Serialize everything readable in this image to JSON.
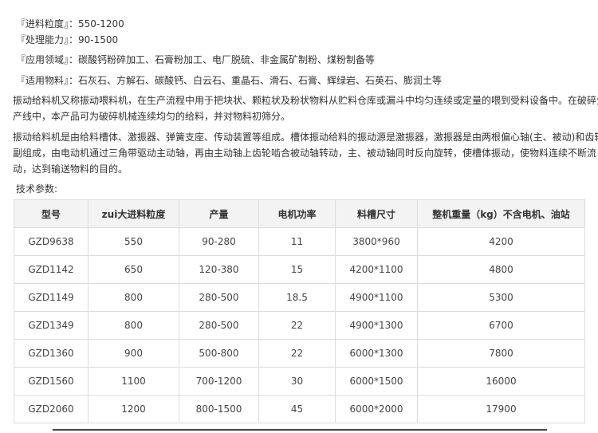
{
  "specs": [
    {
      "label": "『进料粒度』",
      "sep": "：",
      "value": "550-1200"
    },
    {
      "label": "『处理能力』",
      "sep": "：",
      "value": "90-1500"
    },
    {
      "label": "『应用领域』",
      "sep": "：",
      "value": "碳酸钙粉碎加工、石膏粉加工、电厂脱硫、非金属矿制粉、煤粉制备等"
    },
    {
      "label": "『适用物料』",
      "sep": "：",
      "value": "石灰石、方解石、碳酸钙、白云石、重晶石、滑石、石膏、辉绿岩、石英石、膨润土等"
    }
  ],
  "intro": {
    "line1": "振动给料机又称振动喂料机，在生产流程中用于把块状、颗粒状及粉状物料从贮料仓库或漏斗中均匀连续或定量的喂到受料设备中。在破碎生",
    "line2": "产线中，本产品可为破碎机械连续均匀的给料，并对物料初筛分。"
  },
  "structure": {
    "line1": "振动给料机是由给料槽体、激振器、弹簧支座、传动装置等组成。槽体振动给料的振动源是激振器，激振器是由两根偏心轴(主、被动)和齿轮",
    "line2": "副组成，由电动机通过三角带驱动主动轴，再由主动轴上齿轮啮合被动轴转动，主、被动轴同时反向旋转，使槽体振动，使物料连续不断流",
    "line3": "动，达到输送物料的目的。"
  },
  "tech_label": "技术参数:",
  "table": {
    "headers": [
      "型号",
      "zui大进料粒度",
      "产量",
      "电机功率",
      "料槽尺寸",
      "整机重量（kg）不含电机、油站"
    ],
    "rows": [
      [
        "GZD9638",
        "550",
        "90-280",
        "11",
        "3800*960",
        "4200"
      ],
      [
        "GZD1142",
        "650",
        "120-380",
        "15",
        "4200*1100",
        "4800"
      ],
      [
        "GZD1149",
        "800",
        "280-500",
        "18.5",
        "4900*1100",
        "5300"
      ],
      [
        "GZD1349",
        "800",
        "280-500",
        "22",
        "4900*1300",
        "6700"
      ],
      [
        "GZD1360",
        "900",
        "500-800",
        "22",
        "6000*1300",
        "7800"
      ],
      [
        "GZD1560",
        "1100",
        "700-1200",
        "30",
        "6000*1500",
        "16000"
      ],
      [
        "GZD2060",
        "1200",
        "800-1500",
        "45",
        "6000*2000",
        "17900"
      ]
    ]
  }
}
